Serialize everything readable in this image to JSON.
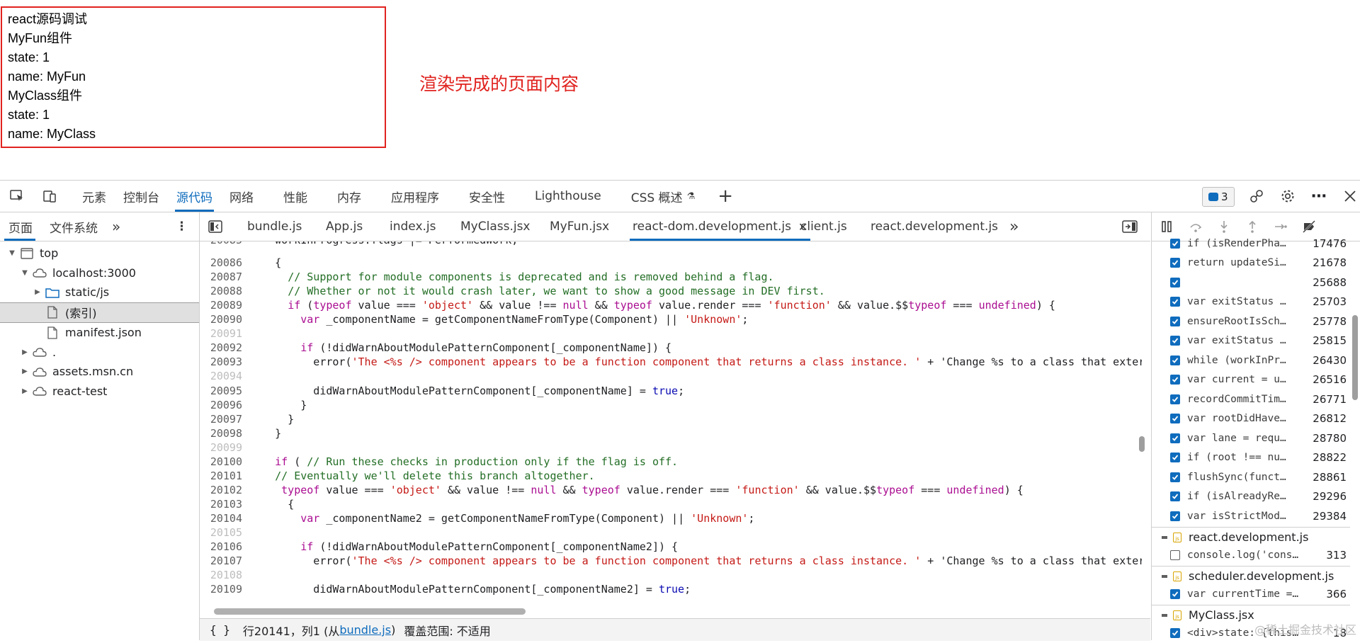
{
  "rendered_page": {
    "lines": [
      "react源码调试",
      "MyFun组件",
      "state: 1",
      "name: MyFun",
      "MyClass组件",
      "state: 1",
      "name: MyClass"
    ],
    "annotation": "渲染完成的页面内容"
  },
  "devtools": {
    "main_tabs": [
      "元素",
      "控制台",
      "源代码",
      "网络",
      "性能",
      "内存",
      "应用程序",
      "安全性",
      "Lighthouse",
      "CSS 概述"
    ],
    "active_main_tab": "源代码",
    "issues_count": "3",
    "sidebar": {
      "tabs": [
        "页面",
        "文件系统"
      ],
      "tree": [
        {
          "label": "top",
          "level": 0,
          "kind": "frame",
          "expanded": true
        },
        {
          "label": "localhost:3000",
          "level": 1,
          "kind": "cloud",
          "expanded": true
        },
        {
          "label": "static/js",
          "level": 2,
          "kind": "folder",
          "expanded": false
        },
        {
          "label": "(索引)",
          "level": 2,
          "kind": "file",
          "selected": true
        },
        {
          "label": "manifest.json",
          "level": 2,
          "kind": "file"
        },
        {
          "label": ".",
          "level": 1,
          "kind": "cloud",
          "expanded": false
        },
        {
          "label": "assets.msn.cn",
          "level": 1,
          "kind": "cloud",
          "expanded": false
        },
        {
          "label": "react-test",
          "level": 1,
          "kind": "cloud",
          "expanded": false
        }
      ]
    },
    "editor": {
      "tabs": [
        "bundle.js",
        "App.js",
        "index.js",
        "MyClass.jsx",
        "MyFun.jsx",
        "react-dom.development.js",
        "client.js",
        "react.development.js"
      ],
      "active_tab": "react-dom.development.js",
      "status": {
        "position": "行20141，列1 (从",
        "source_link": "bundle.js",
        "source_close": ")",
        "coverage": "覆盖范围: 不适用"
      },
      "code_lines": [
        {
          "n": "20085",
          "t": "    workInProgress.flags |= PerformedWork;",
          "blank": false
        },
        {
          "n": "20086",
          "t": "    {",
          "blank": false
        },
        {
          "n": "20087",
          "t": "      // Support for module components is deprecated and is removed behind a flag.",
          "blank": false
        },
        {
          "n": "20088",
          "t": "      // Whether or not it would crash later, we want to show a good message in DEV first.",
          "blank": false
        },
        {
          "n": "20089",
          "t": "      if (typeof value === 'object' && value !== null && typeof value.render === 'function' && value.$$typeof === undefined) {",
          "blank": false
        },
        {
          "n": "20090",
          "t": "        var _componentName = getComponentNameFromType(Component) || 'Unknown';",
          "blank": false
        },
        {
          "n": "20091",
          "t": "",
          "blank": true
        },
        {
          "n": "20092",
          "t": "        if (!didWarnAboutModulePatternComponent[_componentName]) {",
          "blank": false
        },
        {
          "n": "20093",
          "t": "          error('The <%s /> component appears to be a function component that returns a class instance. ' + 'Change %s to a class that exter",
          "blank": false
        },
        {
          "n": "20094",
          "t": "",
          "blank": true
        },
        {
          "n": "20095",
          "t": "          didWarnAboutModulePatternComponent[_componentName] = true;",
          "blank": false
        },
        {
          "n": "20096",
          "t": "        }",
          "blank": false
        },
        {
          "n": "20097",
          "t": "      }",
          "blank": false
        },
        {
          "n": "20098",
          "t": "    }",
          "blank": false
        },
        {
          "n": "20099",
          "t": "",
          "blank": true
        },
        {
          "n": "20100",
          "t": "    if ( // Run these checks in production only if the flag is off.",
          "blank": false
        },
        {
          "n": "20101",
          "t": "    // Eventually we'll delete this branch altogether.",
          "blank": false
        },
        {
          "n": "20102",
          "t": "     typeof value === 'object' && value !== null && typeof value.render === 'function' && value.$$typeof === undefined) {",
          "blank": false
        },
        {
          "n": "20103",
          "t": "      {",
          "blank": false
        },
        {
          "n": "20104",
          "t": "        var _componentName2 = getComponentNameFromType(Component) || 'Unknown';",
          "blank": false
        },
        {
          "n": "20105",
          "t": "",
          "blank": true
        },
        {
          "n": "20106",
          "t": "        if (!didWarnAboutModulePatternComponent[_componentName2]) {",
          "blank": false
        },
        {
          "n": "20107",
          "t": "          error('The <%s /> component appears to be a function component that returns a class instance. ' + 'Change %s to a class that exter",
          "blank": false
        },
        {
          "n": "20108",
          "t": "",
          "blank": true
        },
        {
          "n": "20109",
          "t": "          didWarnAboutModulePatternComponent[_componentName2] = true;",
          "blank": false
        }
      ]
    },
    "breakpoints": {
      "groups": [
        {
          "file": "",
          "items": [
            {
              "code": "if (isRenderPha…",
              "line": "17476",
              "checked": true
            },
            {
              "code": "return updateSi…",
              "line": "21678",
              "checked": true
            },
            {
              "code": "",
              "line": "25688",
              "checked": true
            },
            {
              "code": "var exitStatus …",
              "line": "25703",
              "checked": true
            },
            {
              "code": "ensureRootIsSch…",
              "line": "25778",
              "checked": true
            },
            {
              "code": "var exitStatus …",
              "line": "25815",
              "checked": true
            },
            {
              "code": "while (workInPr…",
              "line": "26430",
              "checked": true
            },
            {
              "code": "var current = u…",
              "line": "26516",
              "checked": true
            },
            {
              "code": "recordCommitTim…",
              "line": "26771",
              "checked": true
            },
            {
              "code": "var rootDidHave…",
              "line": "26812",
              "checked": true
            },
            {
              "code": "var lane = requ…",
              "line": "28780",
              "checked": true
            },
            {
              "code": "if (root !== nu…",
              "line": "28822",
              "checked": true
            },
            {
              "code": "flushSync(funct…",
              "line": "28861",
              "checked": true
            },
            {
              "code": "if (isAlreadyRe…",
              "line": "29296",
              "checked": true
            },
            {
              "code": "var isStrictMod…",
              "line": "29384",
              "checked": true
            }
          ]
        },
        {
          "file": "react.development.js",
          "items": [
            {
              "code": "console.log('cons…",
              "line": "313",
              "checked": false
            }
          ]
        },
        {
          "file": "scheduler.development.js",
          "items": [
            {
              "code": "var currentTime =…",
              "line": "366",
              "checked": true
            }
          ]
        },
        {
          "file": "MyClass.jsx",
          "items": [
            {
              "code": "<div>state: {this…",
              "line": "18",
              "checked": true
            }
          ]
        }
      ]
    },
    "watermark": "@稀土掘金技术社区"
  },
  "colors": {
    "accent": "#0f6cbd",
    "annotation_red": "#e0231f",
    "comment": "#236e25",
    "string": "#c41a16",
    "keyword": "#aa0d91"
  }
}
